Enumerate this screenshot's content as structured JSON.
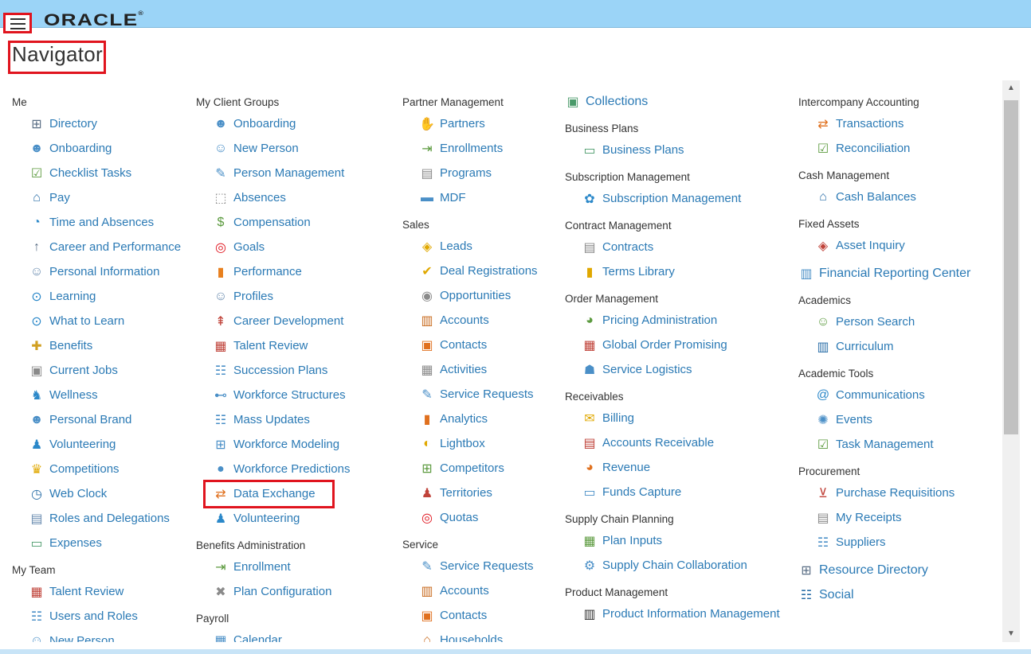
{
  "header": {
    "logo_text": "ORACLE",
    "logo_reg": "®",
    "hamburger_icon": "menu-icon"
  },
  "page": {
    "title": "Navigator"
  },
  "colors": {
    "link": "#2b7ab5",
    "header_bg": "#9bd4f7",
    "highlight": "#e0141e"
  },
  "columns": [
    {
      "groups": [
        {
          "title": "Me",
          "items": [
            {
              "label": "Directory",
              "icon": "org-chart-icon"
            },
            {
              "label": "Onboarding",
              "icon": "people-icon"
            },
            {
              "label": "Checklist Tasks",
              "icon": "checklist-icon"
            },
            {
              "label": "Pay",
              "icon": "bank-icon"
            },
            {
              "label": "Time and Absences",
              "icon": "clock-icon"
            },
            {
              "label": "Career and Performance",
              "icon": "career-icon"
            },
            {
              "label": "Personal Information",
              "icon": "person-icon"
            },
            {
              "label": "Learning",
              "icon": "play-icon"
            },
            {
              "label": "What to Learn",
              "icon": "play-icon"
            },
            {
              "label": "Benefits",
              "icon": "benefits-icon"
            },
            {
              "label": "Current Jobs",
              "icon": "jobs-icon"
            },
            {
              "label": "Wellness",
              "icon": "wellness-icon"
            },
            {
              "label": "Personal Brand",
              "icon": "brand-icon"
            },
            {
              "label": "Volunteering",
              "icon": "volunteer-icon"
            },
            {
              "label": "Competitions",
              "icon": "trophy-icon"
            },
            {
              "label": "Web Clock",
              "icon": "stopwatch-icon"
            },
            {
              "label": "Roles and Delegations",
              "icon": "roles-icon"
            },
            {
              "label": "Expenses",
              "icon": "wallet-icon"
            }
          ]
        },
        {
          "title": "My Team",
          "items": [
            {
              "label": "Talent Review",
              "icon": "grid-icon"
            },
            {
              "label": "Users and Roles",
              "icon": "users-icon"
            },
            {
              "label": "New Person",
              "icon": "new-person-icon"
            }
          ]
        }
      ]
    },
    {
      "groups": [
        {
          "title": "My Client Groups",
          "items": [
            {
              "label": "Onboarding",
              "icon": "people-icon"
            },
            {
              "label": "New Person",
              "icon": "new-person-icon"
            },
            {
              "label": "Person Management",
              "icon": "person-edit-icon"
            },
            {
              "label": "Absences",
              "icon": "absences-icon"
            },
            {
              "label": "Compensation",
              "icon": "compensation-icon"
            },
            {
              "label": "Goals",
              "icon": "goals-icon"
            },
            {
              "label": "Performance",
              "icon": "bar-chart-icon"
            },
            {
              "label": "Profiles",
              "icon": "profile-icon"
            },
            {
              "label": "Career Development",
              "icon": "signpost-icon"
            },
            {
              "label": "Talent Review",
              "icon": "grid-icon"
            },
            {
              "label": "Succession Plans",
              "icon": "succession-icon"
            },
            {
              "label": "Workforce Structures",
              "icon": "structure-icon"
            },
            {
              "label": "Mass Updates",
              "icon": "mass-update-icon"
            },
            {
              "label": "Workforce Modeling",
              "icon": "modeling-icon"
            },
            {
              "label": "Workforce Predictions",
              "icon": "crystal-ball-icon"
            },
            {
              "label": "Data Exchange",
              "icon": "exchange-icon"
            },
            {
              "label": "Volunteering",
              "icon": "volunteer-icon"
            }
          ]
        },
        {
          "title": "Benefits Administration",
          "items": [
            {
              "label": "Enrollment",
              "icon": "enroll-icon"
            },
            {
              "label": "Plan Configuration",
              "icon": "tools-icon"
            }
          ]
        },
        {
          "title": "Payroll",
          "items": [
            {
              "label": "Calendar",
              "icon": "calendar-icon"
            }
          ]
        }
      ]
    },
    {
      "groups": [
        {
          "title": "Partner Management",
          "items": [
            {
              "label": "Partners",
              "icon": "handshake-icon"
            },
            {
              "label": "Enrollments",
              "icon": "enroll-icon"
            },
            {
              "label": "Programs",
              "icon": "document-icon"
            },
            {
              "label": "MDF",
              "icon": "mdf-icon"
            }
          ]
        },
        {
          "title": "Sales",
          "items": [
            {
              "label": "Leads",
              "icon": "leads-icon"
            },
            {
              "label": "Deal Registrations",
              "icon": "deal-icon"
            },
            {
              "label": "Opportunities",
              "icon": "opportunity-icon"
            },
            {
              "label": "Accounts",
              "icon": "building-icon"
            },
            {
              "label": "Contacts",
              "icon": "contact-card-icon"
            },
            {
              "label": "Activities",
              "icon": "activities-icon"
            },
            {
              "label": "Service Requests",
              "icon": "service-icon"
            },
            {
              "label": "Analytics",
              "icon": "analytics-icon"
            },
            {
              "label": "Lightbox",
              "icon": "lightbox-icon"
            },
            {
              "label": "Competitors",
              "icon": "competitors-icon"
            },
            {
              "label": "Territories",
              "icon": "territories-icon"
            },
            {
              "label": "Quotas",
              "icon": "target-icon"
            }
          ]
        },
        {
          "title": "Service",
          "items": [
            {
              "label": "Service Requests",
              "icon": "service-icon"
            },
            {
              "label": "Accounts",
              "icon": "building-icon"
            },
            {
              "label": "Contacts",
              "icon": "contact-card-icon"
            },
            {
              "label": "Households",
              "icon": "household-icon"
            }
          ]
        }
      ]
    },
    {
      "groups": [
        {
          "title": "",
          "items": [
            {
              "label": "Collections",
              "icon": "collections-icon",
              "top": true
            }
          ]
        },
        {
          "title": "Business Plans",
          "items": [
            {
              "label": "Business Plans",
              "icon": "business-plan-icon"
            }
          ]
        },
        {
          "title": "Subscription Management",
          "items": [
            {
              "label": "Subscription Management",
              "icon": "subscription-icon"
            }
          ]
        },
        {
          "title": "Contract Management",
          "items": [
            {
              "label": "Contracts",
              "icon": "contract-icon"
            },
            {
              "label": "Terms Library",
              "icon": "library-icon"
            }
          ]
        },
        {
          "title": "Order Management",
          "items": [
            {
              "label": "Pricing Administration",
              "icon": "pricing-icon"
            },
            {
              "label": "Global Order Promising",
              "icon": "calendar-grid-icon"
            },
            {
              "label": "Service Logistics",
              "icon": "logistics-icon"
            }
          ]
        },
        {
          "title": "Receivables",
          "items": [
            {
              "label": "Billing",
              "icon": "envelope-icon"
            },
            {
              "label": "Accounts Receivable",
              "icon": "receivable-icon"
            },
            {
              "label": "Revenue",
              "icon": "pie-icon"
            },
            {
              "label": "Funds Capture",
              "icon": "funds-icon"
            }
          ]
        },
        {
          "title": "Supply Chain Planning",
          "items": [
            {
              "label": "Plan Inputs",
              "icon": "plan-inputs-icon"
            },
            {
              "label": "Supply Chain Collaboration",
              "icon": "collaboration-icon"
            }
          ]
        },
        {
          "title": "Product Management",
          "items": [
            {
              "label": "Product Information Management",
              "icon": "barcode-icon"
            }
          ]
        }
      ]
    },
    {
      "groups": [
        {
          "title": "Intercompany Accounting",
          "items": [
            {
              "label": "Transactions",
              "icon": "transfer-icon"
            },
            {
              "label": "Reconciliation",
              "icon": "reconcile-icon"
            }
          ]
        },
        {
          "title": "Cash Management",
          "items": [
            {
              "label": "Cash Balances",
              "icon": "bank-icon"
            }
          ]
        },
        {
          "title": "Fixed Assets",
          "items": [
            {
              "label": "Asset Inquiry",
              "icon": "asset-icon"
            }
          ]
        },
        {
          "title": "",
          "items": [
            {
              "label": "Financial Reporting Center",
              "icon": "report-icon",
              "top": true
            }
          ]
        },
        {
          "title": "Academics",
          "items": [
            {
              "label": "Person Search",
              "icon": "person-search-icon"
            },
            {
              "label": "Curriculum",
              "icon": "books-icon"
            }
          ]
        },
        {
          "title": "Academic Tools",
          "items": [
            {
              "label": "Communications",
              "icon": "at-icon"
            },
            {
              "label": "Events",
              "icon": "events-icon"
            },
            {
              "label": "Task Management",
              "icon": "checklist-icon"
            }
          ]
        },
        {
          "title": "Procurement",
          "items": [
            {
              "label": "Purchase Requisitions",
              "icon": "cart-icon"
            },
            {
              "label": "My Receipts",
              "icon": "receipt-icon"
            },
            {
              "label": "Suppliers",
              "icon": "suppliers-icon"
            }
          ]
        },
        {
          "title": "",
          "items": [
            {
              "label": "Resource Directory",
              "icon": "org-chart-icon",
              "top": true
            },
            {
              "label": "Social",
              "icon": "social-icon",
              "top": true
            }
          ]
        }
      ]
    }
  ]
}
